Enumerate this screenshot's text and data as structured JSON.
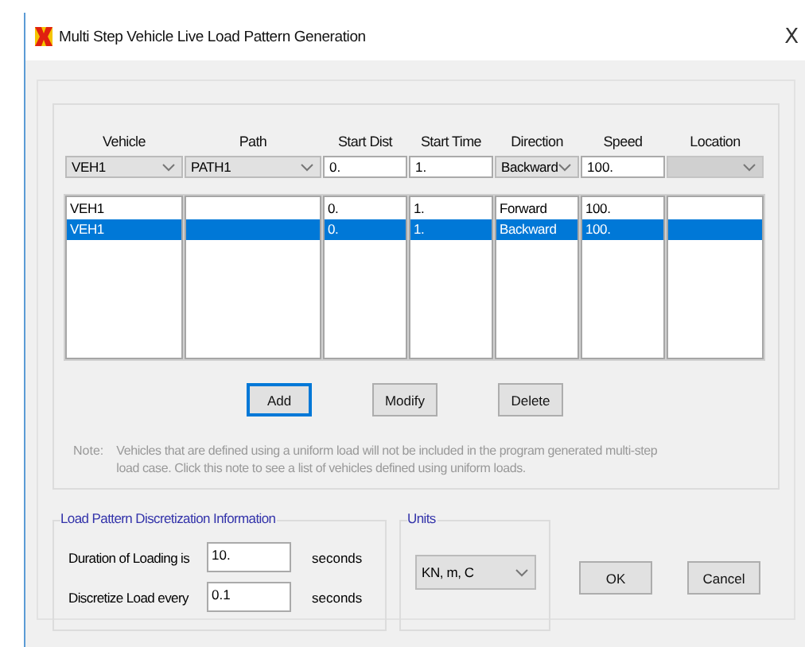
{
  "window": {
    "title": "Multi Step Vehicle Live Load Pattern Generation",
    "close": "X"
  },
  "columns": [
    "Vehicle",
    "Path",
    "Start Dist",
    "Start Time",
    "Direction",
    "Speed",
    "Location"
  ],
  "entry": [
    {
      "kind": "combo",
      "value": "VEH1",
      "disabled": false
    },
    {
      "kind": "combo",
      "value": "PATH1",
      "disabled": false
    },
    {
      "kind": "text",
      "value": "0."
    },
    {
      "kind": "text",
      "value": "1."
    },
    {
      "kind": "combo",
      "value": "Backward",
      "disabled": false
    },
    {
      "kind": "text",
      "value": "100."
    },
    {
      "kind": "combo",
      "disabled": true
    }
  ],
  "rows": [
    {
      "vehicle": "VEH1",
      "start_dist": "0.",
      "start_time": "1.",
      "direction": "Forward",
      "speed": "100.",
      "selected": false
    },
    {
      "vehicle": "VEH1",
      "start_dist": "0.",
      "start_time": "1.",
      "direction": "Backward",
      "speed": "100.",
      "selected": true
    }
  ],
  "buttons": [
    {
      "label": "Add",
      "focused": true
    },
    {
      "label": "Modify",
      "focused": false
    },
    {
      "label": "Delete",
      "focused": false
    }
  ],
  "note": {
    "label": "Note:",
    "text": "Vehicles that are defined using a uniform load will not be included in the program generated multi-step load case.  Click this note to see a list of vehicles defined using uniform loads."
  },
  "discretization": {
    "title": "Load Pattern Discretization Information",
    "fields": [
      {
        "label": "Duration of Loading is",
        "value": "10.",
        "unit": "seconds"
      },
      {
        "label": "Discretize Load every",
        "value": "0.1",
        "unit": "seconds"
      }
    ]
  },
  "units": {
    "title": "Units",
    "value": "KN, m, C"
  },
  "dialog_buttons": [
    {
      "label": "OK"
    },
    {
      "label": "Cancel"
    }
  ]
}
